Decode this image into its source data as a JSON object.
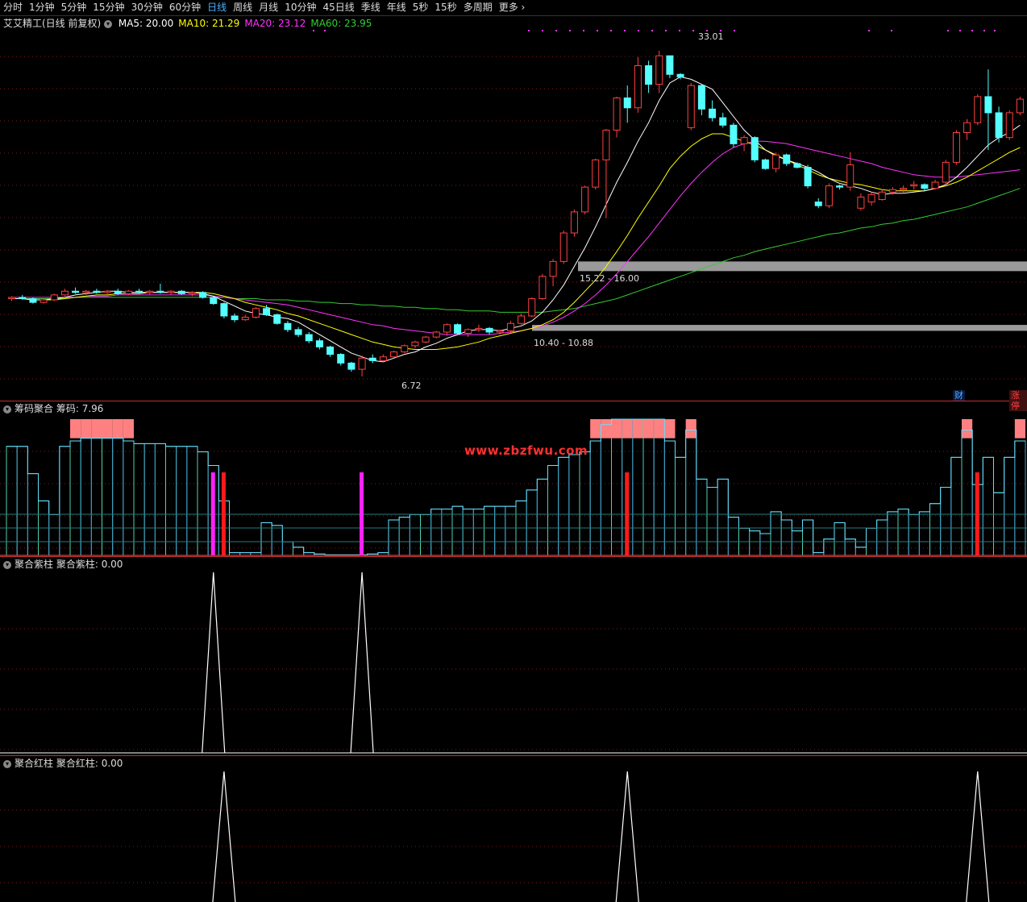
{
  "tabs": [
    {
      "label": "分时",
      "active": false
    },
    {
      "label": "1分钟",
      "active": false
    },
    {
      "label": "5分钟",
      "active": false
    },
    {
      "label": "15分钟",
      "active": false
    },
    {
      "label": "30分钟",
      "active": false
    },
    {
      "label": "60分钟",
      "active": false
    },
    {
      "label": "日线",
      "active": true
    },
    {
      "label": "周线",
      "active": false
    },
    {
      "label": "月线",
      "active": false
    },
    {
      "label": "10分钟",
      "active": false
    },
    {
      "label": "45日线",
      "active": false
    },
    {
      "label": "季线",
      "active": false
    },
    {
      "label": "年线",
      "active": false
    },
    {
      "label": "5秒",
      "active": false
    },
    {
      "label": "15秒",
      "active": false
    },
    {
      "label": "多周期",
      "active": false
    },
    {
      "label": "更多",
      "active": false
    }
  ],
  "main_panel": {
    "title": "艾艾精工(日线 前复权)",
    "ma": [
      {
        "label": "MA5: 20.00",
        "color": "#ffffff"
      },
      {
        "label": "MA10: 21.29",
        "color": "#ffff00"
      },
      {
        "label": "MA20: 23.12",
        "color": "#ff33ff"
      },
      {
        "label": "MA60: 23.95",
        "color": "#33cc33"
      }
    ],
    "high_label": "33.01",
    "low_label": "6.72",
    "band_upper_label": "15.22 - 16.00",
    "band_lower_label": "10.40 - 10.88",
    "badge_cai": "财",
    "badge_zhang": "涨停"
  },
  "panel2": {
    "title": "筹码聚合",
    "value_label": "筹码: 7.96"
  },
  "panel3": {
    "title": "聚合紫柱",
    "value_label": "聚合紫柱: 0.00"
  },
  "panel4": {
    "title": "聚合红柱",
    "value_label": "聚合红柱: 0.00"
  },
  "watermark": "www.zbzfwu.com",
  "colors": {
    "up": "#ff4040",
    "down": "#54ffff",
    "ma5": "#ffffff",
    "ma10": "#ffff00",
    "ma20": "#ff33ff",
    "ma60": "#33cc33",
    "grid": "#8a1a1a"
  },
  "chart_data": {
    "type": "candlestick",
    "candles": [
      [
        13.0,
        13.2,
        12.8,
        13.1
      ],
      [
        13.1,
        13.3,
        12.9,
        13.0
      ],
      [
        13.0,
        13.1,
        12.6,
        12.7
      ],
      [
        12.7,
        13.0,
        12.6,
        12.9
      ],
      [
        12.9,
        13.4,
        12.8,
        13.3
      ],
      [
        13.3,
        13.8,
        13.2,
        13.6
      ],
      [
        13.6,
        13.9,
        13.4,
        13.5
      ],
      [
        13.5,
        13.7,
        13.3,
        13.6
      ],
      [
        13.6,
        13.8,
        13.4,
        13.5
      ],
      [
        13.5,
        13.7,
        13.3,
        13.6
      ],
      [
        13.6,
        13.8,
        13.3,
        13.4
      ],
      [
        13.4,
        13.7,
        13.3,
        13.6
      ],
      [
        13.6,
        13.8,
        13.4,
        13.5
      ],
      [
        13.5,
        13.7,
        13.3,
        13.6
      ],
      [
        13.6,
        14.2,
        13.4,
        13.5
      ],
      [
        13.5,
        13.7,
        13.3,
        13.6
      ],
      [
        13.6,
        13.7,
        13.3,
        13.4
      ],
      [
        13.4,
        13.6,
        13.2,
        13.5
      ],
      [
        13.5,
        13.6,
        13.0,
        13.1
      ],
      [
        13.1,
        13.2,
        12.5,
        12.6
      ],
      [
        12.6,
        12.7,
        11.4,
        11.6
      ],
      [
        11.6,
        11.8,
        11.1,
        11.3
      ],
      [
        11.3,
        11.7,
        11.2,
        11.5
      ],
      [
        11.5,
        12.3,
        11.4,
        12.2
      ],
      [
        12.2,
        12.5,
        11.6,
        11.7
      ],
      [
        11.7,
        11.8,
        10.9,
        11.0
      ],
      [
        11.0,
        11.2,
        10.3,
        10.5
      ],
      [
        10.5,
        10.7,
        9.9,
        10.1
      ],
      [
        10.1,
        10.3,
        9.4,
        9.6
      ],
      [
        9.6,
        9.8,
        8.9,
        9.1
      ],
      [
        9.1,
        9.2,
        8.3,
        8.5
      ],
      [
        8.5,
        8.6,
        7.6,
        7.8
      ],
      [
        7.8,
        7.9,
        7.1,
        7.3
      ],
      [
        7.3,
        8.4,
        6.72,
        8.2
      ],
      [
        8.2,
        8.5,
        7.8,
        8.0
      ],
      [
        8.0,
        8.5,
        7.9,
        8.3
      ],
      [
        8.3,
        8.8,
        8.2,
        8.7
      ],
      [
        8.7,
        9.3,
        8.6,
        9.2
      ],
      [
        9.2,
        9.6,
        9.0,
        9.5
      ],
      [
        9.5,
        10.0,
        9.4,
        9.9
      ],
      [
        9.9,
        10.4,
        9.8,
        10.3
      ],
      [
        10.3,
        11.0,
        10.0,
        10.9
      ],
      [
        10.9,
        11.0,
        10.1,
        10.2
      ],
      [
        10.2,
        10.6,
        9.9,
        10.5
      ],
      [
        10.5,
        10.9,
        10.3,
        10.6
      ],
      [
        10.6,
        10.7,
        10.1,
        10.3
      ],
      [
        10.3,
        10.5,
        10.1,
        10.4
      ],
      [
        10.4,
        11.2,
        10.2,
        11.0
      ],
      [
        11.0,
        11.8,
        10.9,
        11.6
      ],
      [
        11.6,
        13.1,
        11.5,
        13.0
      ],
      [
        13.0,
        15.0,
        12.9,
        14.8
      ],
      [
        14.8,
        16.2,
        14.0,
        16.0
      ],
      [
        16.0,
        18.5,
        15.8,
        18.3
      ],
      [
        18.3,
        20.2,
        18.0,
        20.0
      ],
      [
        20.0,
        22.1,
        19.8,
        22.0
      ],
      [
        22.0,
        24.3,
        21.8,
        24.2
      ],
      [
        24.2,
        26.7,
        19.5,
        26.6
      ],
      [
        26.6,
        29.3,
        26.0,
        29.2
      ],
      [
        29.2,
        30.2,
        27.2,
        28.4
      ],
      [
        28.4,
        32.5,
        28.0,
        31.8
      ],
      [
        31.8,
        32.2,
        29.6,
        30.3
      ],
      [
        30.3,
        33.01,
        29.6,
        32.6
      ],
      [
        32.6,
        32.6,
        30.8,
        31.1
      ],
      [
        31.1,
        31.2,
        30.7,
        30.9
      ],
      [
        26.8,
        30.4,
        26.6,
        30.2
      ],
      [
        30.2,
        30.3,
        27.8,
        28.3
      ],
      [
        28.3,
        29.0,
        27.3,
        27.6
      ],
      [
        27.6,
        28.0,
        26.8,
        27.0
      ],
      [
        27.0,
        27.2,
        25.2,
        25.5
      ],
      [
        25.5,
        26.2,
        24.9,
        26.0
      ],
      [
        26.0,
        26.1,
        24.0,
        24.2
      ],
      [
        24.2,
        24.3,
        23.4,
        23.5
      ],
      [
        23.5,
        24.8,
        23.2,
        24.6
      ],
      [
        24.6,
        24.7,
        23.7,
        23.9
      ],
      [
        23.9,
        24.0,
        23.5,
        23.6
      ],
      [
        23.6,
        23.8,
        21.9,
        22.1
      ],
      [
        20.8,
        21.1,
        20.3,
        20.5
      ],
      [
        20.5,
        22.3,
        20.3,
        22.1
      ],
      [
        22.1,
        22.2,
        21.8,
        22.0
      ],
      [
        22.0,
        24.8,
        21.7,
        23.8
      ],
      [
        20.3,
        21.5,
        20.1,
        21.2
      ],
      [
        20.8,
        21.6,
        20.5,
        21.4
      ],
      [
        21.0,
        21.8,
        20.9,
        21.6
      ],
      [
        21.6,
        22.0,
        21.4,
        21.8
      ],
      [
        21.8,
        22.1,
        21.5,
        21.9
      ],
      [
        22.1,
        22.5,
        21.8,
        22.2
      ],
      [
        22.2,
        22.3,
        21.7,
        21.9
      ],
      [
        21.9,
        22.6,
        21.8,
        22.4
      ],
      [
        22.4,
        24.2,
        22.2,
        24.0
      ],
      [
        24.0,
        26.6,
        23.8,
        26.4
      ],
      [
        26.4,
        27.5,
        25.8,
        27.2
      ],
      [
        27.2,
        29.5,
        27.0,
        29.3
      ],
      [
        29.3,
        31.5,
        25.0,
        28.0
      ],
      [
        28.0,
        28.5,
        25.6,
        26.0
      ],
      [
        26.0,
        28.2,
        25.8,
        28.0
      ],
      [
        28.0,
        29.3,
        27.8,
        29.1
      ]
    ],
    "ma5": [
      13.0,
      13.0,
      12.9,
      12.9,
      13.0,
      13.1,
      13.3,
      13.4,
      13.5,
      13.6,
      13.6,
      13.5,
      13.5,
      13.5,
      13.5,
      13.5,
      13.5,
      13.5,
      13.4,
      13.2,
      12.8,
      12.4,
      12.0,
      11.8,
      11.7,
      11.5,
      11.4,
      11.1,
      10.6,
      10.1,
      9.6,
      9.1,
      8.6,
      8.3,
      8.0,
      7.9,
      8.2,
      8.5,
      8.7,
      9.1,
      9.4,
      9.8,
      10.1,
      10.4,
      10.5,
      10.5,
      10.4,
      10.6,
      10.8,
      11.2,
      11.9,
      12.9,
      14.1,
      15.6,
      17.1,
      18.8,
      20.6,
      22.4,
      24.0,
      25.7,
      27.2,
      29.0,
      30.4,
      30.9,
      30.7,
      30.3,
      29.9,
      28.8,
      27.7,
      26.6,
      25.8,
      25.0,
      24.5,
      24.2,
      23.9,
      23.6,
      23.2,
      22.7,
      22.3,
      22.1,
      21.9,
      21.6,
      21.4,
      21.5,
      21.5,
      21.6,
      21.7,
      21.9,
      22.2,
      22.8,
      23.6,
      24.5,
      25.4,
      26.0,
      26.4,
      27.0
    ],
    "ma10": [
      13.0,
      13.0,
      12.9,
      12.9,
      12.9,
      13.0,
      13.1,
      13.2,
      13.3,
      13.3,
      13.4,
      13.4,
      13.4,
      13.5,
      13.5,
      13.5,
      13.5,
      13.5,
      13.5,
      13.4,
      13.2,
      13.0,
      12.7,
      12.5,
      12.3,
      12.1,
      11.8,
      11.6,
      11.3,
      11.0,
      10.7,
      10.4,
      10.1,
      9.8,
      9.5,
      9.3,
      9.1,
      9.0,
      8.9,
      8.9,
      8.9,
      9.0,
      9.1,
      9.3,
      9.5,
      9.8,
      10.0,
      10.2,
      10.4,
      10.6,
      10.9,
      11.3,
      11.9,
      12.7,
      13.6,
      14.5,
      15.6,
      16.8,
      18.1,
      19.5,
      20.8,
      22.1,
      23.5,
      24.5,
      25.3,
      25.9,
      26.3,
      26.3,
      26.0,
      25.7,
      25.4,
      25.0,
      24.6,
      24.2,
      23.8,
      23.4,
      23.0,
      22.7,
      22.5,
      22.3,
      22.2,
      22.0,
      21.8,
      21.7,
      21.7,
      21.7,
      21.7,
      21.9,
      22.1,
      22.4,
      22.8,
      23.3,
      23.8,
      24.3,
      24.8,
      25.2
    ],
    "ma20": [
      13.1,
      13.1,
      13.1,
      13.1,
      13.1,
      13.1,
      13.1,
      13.2,
      13.2,
      13.2,
      13.3,
      13.3,
      13.3,
      13.3,
      13.3,
      13.3,
      13.3,
      13.3,
      13.3,
      13.2,
      13.1,
      13.0,
      12.9,
      12.8,
      12.7,
      12.6,
      12.5,
      12.3,
      12.1,
      11.9,
      11.7,
      11.5,
      11.3,
      11.1,
      10.9,
      10.8,
      10.6,
      10.5,
      10.4,
      10.3,
      10.2,
      10.1,
      10.1,
      10.1,
      10.1,
      10.1,
      10.2,
      10.3,
      10.4,
      10.6,
      10.8,
      11.1,
      11.5,
      12.0,
      12.6,
      13.3,
      14.1,
      15.0,
      16.0,
      17.0,
      18.0,
      19.1,
      20.2,
      21.3,
      22.3,
      23.2,
      24.0,
      24.7,
      25.2,
      25.5,
      25.7,
      25.7,
      25.6,
      25.5,
      25.3,
      25.1,
      24.9,
      24.7,
      24.5,
      24.3,
      24.1,
      23.9,
      23.6,
      23.4,
      23.2,
      23.0,
      22.9,
      22.8,
      22.8,
      22.8,
      22.9,
      23.0,
      23.1,
      23.2,
      23.3,
      23.4
    ],
    "ma60": [
      13.0,
      13.0,
      13.0,
      13.0,
      13.0,
      13.0,
      13.1,
      13.1,
      13.1,
      13.1,
      13.1,
      13.1,
      13.1,
      13.1,
      13.1,
      13.1,
      13.1,
      13.1,
      13.1,
      13.1,
      13.1,
      13.0,
      13.0,
      13.0,
      12.9,
      12.9,
      12.9,
      12.8,
      12.8,
      12.7,
      12.7,
      12.6,
      12.6,
      12.5,
      12.5,
      12.4,
      12.4,
      12.3,
      12.3,
      12.2,
      12.2,
      12.1,
      12.1,
      12.0,
      12.0,
      12.0,
      11.9,
      11.9,
      11.9,
      11.9,
      11.9,
      12.0,
      12.1,
      12.2,
      12.4,
      12.6,
      12.8,
      13.0,
      13.3,
      13.6,
      13.9,
      14.2,
      14.5,
      14.8,
      15.1,
      15.4,
      15.7,
      16.0,
      16.3,
      16.5,
      16.8,
      17.0,
      17.2,
      17.4,
      17.6,
      17.8,
      18.0,
      18.2,
      18.3,
      18.5,
      18.7,
      18.8,
      19.0,
      19.1,
      19.3,
      19.4,
      19.6,
      19.8,
      20.0,
      20.2,
      20.4,
      20.7,
      21.0,
      21.3,
      21.6,
      21.9
    ],
    "chips": [
      4,
      4,
      3,
      2,
      1.5,
      4,
      4.2,
      4.3,
      4.3,
      4.3,
      4.3,
      4.2,
      4.1,
      4.1,
      4.1,
      4.0,
      4.0,
      4.0,
      3.8,
      3.3,
      2.0,
      0.1,
      0.1,
      0.1,
      1.2,
      1.1,
      0.5,
      0.3,
      0.1,
      0.05,
      0.02,
      0.02,
      0.02,
      0.02,
      0.05,
      0.1,
      1.3,
      1.4,
      1.5,
      1.5,
      1.7,
      1.7,
      1.8,
      1.7,
      1.7,
      1.8,
      1.8,
      1.8,
      2.0,
      2.4,
      2.8,
      3.3,
      3.6,
      3.7,
      3.8,
      4.2,
      4.8,
      5.0,
      5.0,
      5.0,
      5.0,
      5.0,
      4.2,
      3.6,
      4.6,
      2.8,
      2.5,
      2.8,
      1.4,
      1.0,
      0.9,
      0.8,
      1.6,
      1.3,
      0.9,
      1.3,
      0.1,
      0.6,
      1.2,
      0.6,
      0.3,
      1.0,
      1.3,
      1.6,
      1.7,
      1.5,
      1.6,
      1.9,
      2.5,
      3.6,
      4.6,
      2.6,
      3.6,
      2.3,
      3.6,
      4.2
    ]
  }
}
